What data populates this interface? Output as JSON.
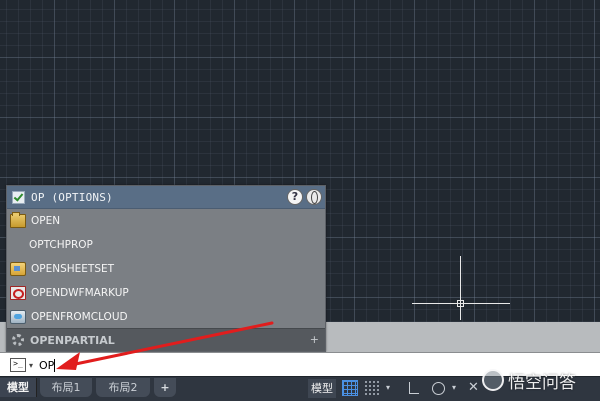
{
  "canvas": {},
  "autocomplete": {
    "header_title": "OP (OPTIONS)",
    "help_label": "?",
    "items": [
      {
        "label": "OPEN",
        "icon": "folder-icon"
      },
      {
        "label": "OPTCHPROP",
        "icon": ""
      },
      {
        "label": "OPENSHEETSET",
        "icon": "sheetset-icon"
      },
      {
        "label": "OPENDWFMARKUP",
        "icon": "markup-icon"
      },
      {
        "label": "OPENFROMCLOUD",
        "icon": "cloud-icon"
      }
    ],
    "footer_label": "OPENPARTIAL",
    "footer_plus": "+"
  },
  "command_line": {
    "icon_label": ">_",
    "caret": "▾",
    "value": "OP"
  },
  "layout_tabs": {
    "active": "模型",
    "tabs": [
      "布局1",
      "布局2"
    ],
    "add_label": "+"
  },
  "status": {
    "model_label": "模型",
    "dropdown1": "▾",
    "dropdown2": "▾",
    "snapx": "✕"
  },
  "watermark": {
    "text": "悟空问答"
  },
  "colors": {
    "canvas_bg": "#212830",
    "panel_header": "#596e86",
    "arrow": "#e11d1d"
  }
}
